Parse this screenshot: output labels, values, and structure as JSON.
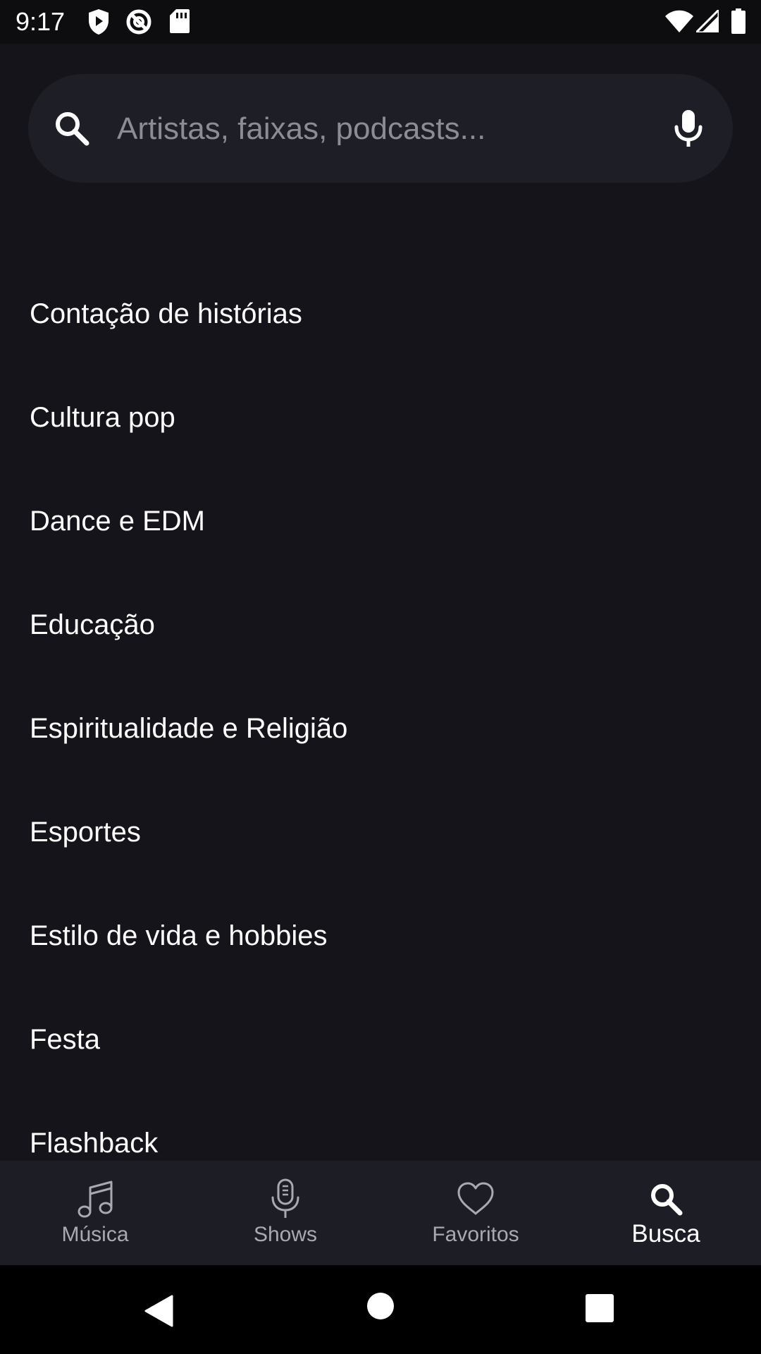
{
  "status_bar": {
    "time": "9:17",
    "icons": [
      "shield-play-icon",
      "blocked-circle-icon",
      "sd-card-icon",
      "wifi-icon",
      "cell-signal-icon",
      "battery-icon"
    ]
  },
  "search": {
    "placeholder": "Artistas, faixas, podcasts...",
    "value": "",
    "search_icon": "search-icon",
    "mic_icon": "mic-icon"
  },
  "genres": [
    "Contação de histórias",
    "Cultura pop",
    "Dance e EDM",
    "Educação",
    "Espiritualidade e Religião",
    "Esportes",
    "Estilo de vida e hobbies",
    "Festa",
    "Flashback"
  ],
  "bottom_nav": {
    "tabs": [
      {
        "label": "Música",
        "icon": "music-note-icon",
        "active": false
      },
      {
        "label": "Shows",
        "icon": "microphone-icon",
        "active": false
      },
      {
        "label": "Favoritos",
        "icon": "heart-icon",
        "active": false
      },
      {
        "label": "Busca",
        "icon": "search-icon",
        "active": true
      }
    ]
  },
  "system_nav": {
    "icons": [
      "back-icon",
      "home-icon",
      "recents-icon"
    ]
  },
  "colors": {
    "background": "#14141a",
    "search_bg": "#1e1e27",
    "nav_bg": "#1d1d26",
    "text": "#ffffff",
    "muted": "#a9a9b1"
  }
}
